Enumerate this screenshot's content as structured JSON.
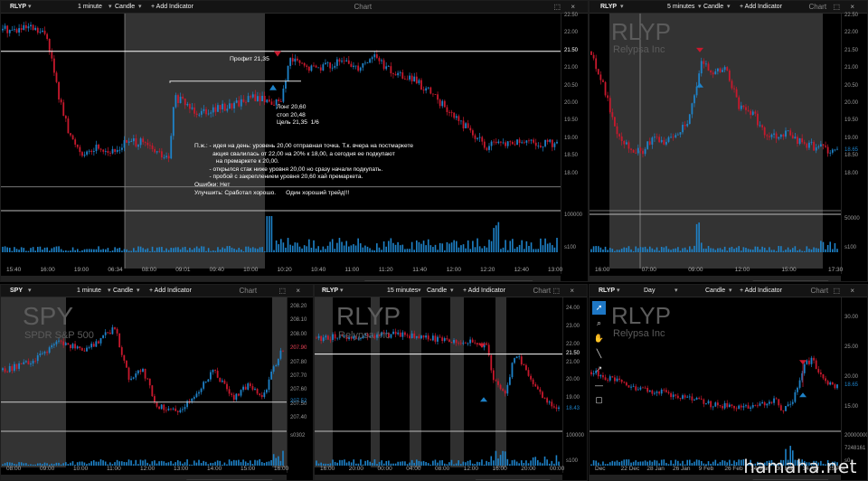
{
  "watermark": "hamaha.net",
  "colors": {
    "up": "#1e82c8",
    "down": "#c8192d",
    "bg": "#000000",
    "grid": "#262626",
    "session": "#3a3a3a",
    "price_tag": "#ffffff",
    "accent": "#1e77c5"
  },
  "toolbar": [
    {
      "icon": "pointer-icon",
      "glyph": "➚"
    },
    {
      "icon": "magnify-icon",
      "glyph": "⌕"
    },
    {
      "icon": "hand-icon",
      "glyph": "✋"
    },
    {
      "icon": "line-icon",
      "glyph": "╲"
    },
    {
      "icon": "arrow-icon",
      "glyph": "↗"
    },
    {
      "icon": "hline-icon",
      "glyph": "—"
    },
    {
      "icon": "box-icon",
      "glyph": "▢"
    }
  ],
  "panes": [
    {
      "symbol": "RLYP",
      "interval": "1 minute",
      "type": "Candle",
      "add": "+ Add Indicator",
      "title": "Chart",
      "watermark": "",
      "company": "",
      "axis": [
        "22.50",
        "22.00",
        "21.50",
        "21.00",
        "20.50",
        "20.00",
        "19.50",
        "19.00",
        "18.50",
        "18.00"
      ],
      "vol_axis": [
        "100000",
        "s100"
      ],
      "times": [
        "15:40",
        "16:00",
        "19:00",
        "06:34",
        "08:00",
        "09:01",
        "09:40",
        "10:00",
        "10:20",
        "10:40",
        "11:00",
        "11:20",
        "11:40",
        "12:00",
        "12:20",
        "12:40",
        "13:00"
      ],
      "hline": "21.50",
      "labels": {
        "profit": "Профит 21,35",
        "entry": "Лонг 20,60\nстоп 20,48\nЦель 21,35  1/6",
        "notes": "П.ж.: - идея на день: уровень 20,00 отправная точка. Т.к. вчера на постмаркете\n           акция свалилась от 22,00 на 20% к 18,00, а сегодня ее подкупают\n             на премаркете к 20,00.\n         - открылся стак ниже уровня 20,00 но сразу начали подкупать.\n         - пробой с закреплением уровня 20,60 хай премаркета.\nОшибки: Нет\nУлучшить: Сработал хорошо.      Один хороший трейд!!!"
      },
      "chart_data": {
        "type": "candlestick",
        "symbol": "RLYP",
        "interval": "1 minute",
        "ylim": [
          17.5,
          22.5
        ],
        "key_levels": {
          "premarket_high": 20.6,
          "entry": 20.6,
          "stop": 20.48,
          "target": 21.35,
          "hline": 21.5
        },
        "path": [
          [
            0.02,
            22.1
          ],
          [
            0.05,
            22.15
          ],
          [
            0.08,
            21.95
          ],
          [
            0.1,
            20.3
          ],
          [
            0.12,
            19.1
          ],
          [
            0.15,
            18.5
          ],
          [
            0.17,
            18.8
          ],
          [
            0.2,
            18.6
          ],
          [
            0.22,
            18.9
          ],
          [
            0.25,
            18.9
          ],
          [
            0.3,
            18.4
          ],
          [
            0.31,
            20.2
          ],
          [
            0.35,
            19.8
          ],
          [
            0.4,
            19.9
          ],
          [
            0.45,
            20.2
          ],
          [
            0.48,
            20.1
          ],
          [
            0.5,
            20.0
          ],
          [
            0.52,
            21.3
          ],
          [
            0.55,
            21.0
          ],
          [
            0.58,
            21.1
          ],
          [
            0.62,
            21.2
          ],
          [
            0.64,
            21.05
          ],
          [
            0.67,
            21.4
          ],
          [
            0.7,
            20.9
          ],
          [
            0.74,
            20.7
          ],
          [
            0.78,
            20.2
          ],
          [
            0.81,
            19.7
          ],
          [
            0.84,
            19.3
          ],
          [
            0.87,
            18.8
          ],
          [
            0.9,
            18.85
          ],
          [
            0.93,
            18.9
          ],
          [
            0.97,
            18.85
          ],
          [
            1.0,
            18.9
          ]
        ]
      }
    },
    {
      "symbol": "RLYP",
      "interval": "5 minutes",
      "type": "Candle",
      "add": "+ Add Indicator",
      "title": "Chart",
      "watermark": "RLYP",
      "company": "Relypsa Inc",
      "axis": [
        "22.50",
        "22.00",
        "21.50",
        "21.00",
        "20.50",
        "20.00",
        "19.50",
        "19.00",
        "18.50",
        "18.00"
      ],
      "vol_axis": [
        "50000",
        "s100"
      ],
      "times": [
        "16:00",
        "07:00",
        "09:00",
        "12:00",
        "15:00",
        "17:30"
      ],
      "price_tag": "18.65",
      "chart_data": {
        "type": "candlestick",
        "symbol": "RLYP",
        "interval": "5 minutes",
        "ylim": [
          17.5,
          22.5
        ],
        "path": [
          [
            0.0,
            21.5
          ],
          [
            0.05,
            20.5
          ],
          [
            0.1,
            19.3
          ],
          [
            0.15,
            18.8
          ],
          [
            0.2,
            18.6
          ],
          [
            0.25,
            19.0
          ],
          [
            0.3,
            18.9
          ],
          [
            0.35,
            19.2
          ],
          [
            0.4,
            19.6
          ],
          [
            0.45,
            21.2
          ],
          [
            0.5,
            20.9
          ],
          [
            0.55,
            21.0
          ],
          [
            0.6,
            19.9
          ],
          [
            0.65,
            19.8
          ],
          [
            0.7,
            19.2
          ],
          [
            0.75,
            19.1
          ],
          [
            0.8,
            19.2
          ],
          [
            0.85,
            18.9
          ],
          [
            0.9,
            18.8
          ],
          [
            1.0,
            18.65
          ]
        ]
      }
    },
    {
      "symbol": "SPY",
      "interval": "1 minute",
      "type": "Candle",
      "add": "+ Add Indicator",
      "title": "Chart",
      "watermark": "SPY",
      "company": "SPDR S&P 500",
      "axis": [
        "208.20",
        "208.10",
        "208.00",
        "207.90",
        "207.80",
        "207.70",
        "207.60",
        "207.50",
        "207.40"
      ],
      "vol_axis": [
        "s0302"
      ],
      "times": [
        "08:00",
        "09:00",
        "10:00",
        "11:00",
        "12:00",
        "13:00",
        "14:00",
        "15:00",
        "16:00"
      ],
      "price_tag": "207.52",
      "tag2": "207.90",
      "chart_data": {
        "type": "candlestick",
        "symbol": "SPY",
        "interval": "1 minute",
        "ylim": [
          207.35,
          208.25
        ],
        "path": [
          [
            0.0,
            207.75
          ],
          [
            0.1,
            207.8
          ],
          [
            0.2,
            207.95
          ],
          [
            0.3,
            207.9
          ],
          [
            0.4,
            208.05
          ],
          [
            0.45,
            207.7
          ],
          [
            0.5,
            207.75
          ],
          [
            0.55,
            207.5
          ],
          [
            0.62,
            207.45
          ],
          [
            0.7,
            207.6
          ],
          [
            0.75,
            207.75
          ],
          [
            0.82,
            207.55
          ],
          [
            0.88,
            207.65
          ],
          [
            0.93,
            207.55
          ],
          [
            0.96,
            207.75
          ],
          [
            1.0,
            207.9
          ]
        ]
      }
    },
    {
      "symbol": "RLYP",
      "interval": "15 minutes",
      "type": "Candle",
      "add": "+ Add Indicator",
      "title": "Chart",
      "watermark": "RLYP",
      "company": "Relypsa Inc",
      "axis": [
        "24.00",
        "23.00",
        "22.00",
        "21.50",
        "21.00",
        "20.00",
        "19.00"
      ],
      "vol_axis": [
        "100000",
        "s100"
      ],
      "times": [
        "16:00",
        "20:00",
        "00:00",
        "04:00",
        "08:00",
        "12:00",
        "16:00",
        "20:00",
        "00:00"
      ],
      "price_tag": "18.43",
      "hline": "21.50",
      "chart_data": {
        "type": "candlestick",
        "symbol": "RLYP",
        "interval": "15 minutes",
        "ylim": [
          17.5,
          24.5
        ],
        "path": [
          [
            0.0,
            22.4
          ],
          [
            0.2,
            22.5
          ],
          [
            0.35,
            22.6
          ],
          [
            0.45,
            22.4
          ],
          [
            0.6,
            22.2
          ],
          [
            0.7,
            22.0
          ],
          [
            0.73,
            20.1
          ],
          [
            0.78,
            19.4
          ],
          [
            0.82,
            21.5
          ],
          [
            0.86,
            20.8
          ],
          [
            0.9,
            19.6
          ],
          [
            0.95,
            18.9
          ],
          [
            1.0,
            18.5
          ]
        ]
      }
    },
    {
      "symbol": "RLYP",
      "interval": "Day",
      "type": "Candle",
      "add": "+ Add Indicator",
      "title": "Chart",
      "watermark": "RLYP",
      "company": "Relypsa Inc",
      "axis": [
        "30.00",
        "25.00",
        "20.00",
        "15.00"
      ],
      "vol_axis": [
        "20000000",
        "7248161",
        "s0"
      ],
      "times": [
        "Dec",
        "22 Dec",
        "28 Jan",
        "26 Jan",
        "9 Feb",
        "26 Feb",
        "14 Mar",
        "30 Mar",
        "14 Apr",
        "25 Apr"
      ],
      "price_tag": "18.65",
      "chart_data": {
        "type": "candlestick",
        "symbol": "RLYP",
        "interval": "Day",
        "ylim": [
          12,
          33
        ],
        "path": [
          [
            0.0,
            21.0
          ],
          [
            0.1,
            19.5
          ],
          [
            0.2,
            18.0
          ],
          [
            0.3,
            17.5
          ],
          [
            0.4,
            16.5
          ],
          [
            0.5,
            15.5
          ],
          [
            0.6,
            15.0
          ],
          [
            0.7,
            15.5
          ],
          [
            0.75,
            16.5
          ],
          [
            0.78,
            14.5
          ],
          [
            0.82,
            16.5
          ],
          [
            0.87,
            22.5
          ],
          [
            0.9,
            23.0
          ],
          [
            0.95,
            19.5
          ],
          [
            1.0,
            18.65
          ]
        ]
      }
    }
  ]
}
